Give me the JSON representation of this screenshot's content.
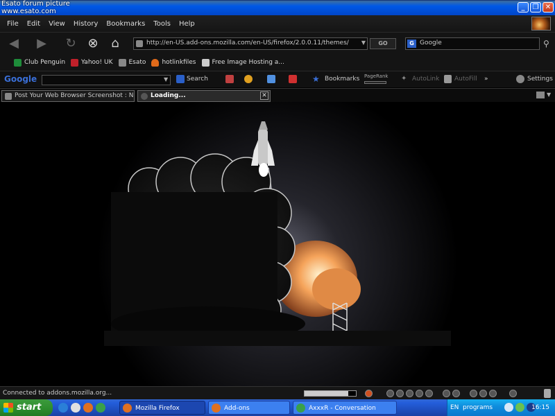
{
  "watermark": {
    "line1": "Esato forum picture",
    "line2": "www.esato.com"
  },
  "window": {
    "title": "Mozilla Firefox",
    "min": "_",
    "max": "❐",
    "close": "✕"
  },
  "menu": [
    "File",
    "Edit",
    "View",
    "History",
    "Bookmarks",
    "Tools",
    "Help"
  ],
  "nav": {
    "url": "http://en-US.add-ons.mozilla.com/en-US/firefox/2.0.0.11/themes/",
    "go_label": "GO",
    "search_value": "Google",
    "search_engine": "G"
  },
  "bookmarks": [
    {
      "label": "Club Penguin",
      "color": "#1e8c3a"
    },
    {
      "label": "Yahoo! UK",
      "color": "#c0202a"
    },
    {
      "label": "Esato",
      "color": "#888888"
    },
    {
      "label": "hotlinkfiles",
      "color": "#e06a1a"
    },
    {
      "label": "Free Image Hosting a...",
      "color": "#cccccc"
    }
  ],
  "google_toolbar": {
    "logo": "Google",
    "search_label": "Search",
    "bookmarks_label": "Bookmarks",
    "pagerank_label": "PageRank",
    "autolink_label": "AutoLink",
    "autofill_label": "AutoFill",
    "more": "»",
    "settings_label": "Settings"
  },
  "tabs": [
    {
      "label": "Post Your Web Browser Screenshot : N...",
      "active": false
    },
    {
      "label": "Loading...",
      "active": true
    }
  ],
  "status": {
    "text": "Connected to addons.mozilla.org...",
    "progress": 0.85
  },
  "taskbar": {
    "start_label": "start",
    "tasks": [
      {
        "label": "Mozilla Firefox",
        "active": true
      },
      {
        "label": "Add-ons",
        "active": false
      },
      {
        "label": "AxxxR - Conversation",
        "active": false
      }
    ],
    "tray_lang": "EN",
    "tray_programs": "programs",
    "tray_time": "16:15"
  }
}
